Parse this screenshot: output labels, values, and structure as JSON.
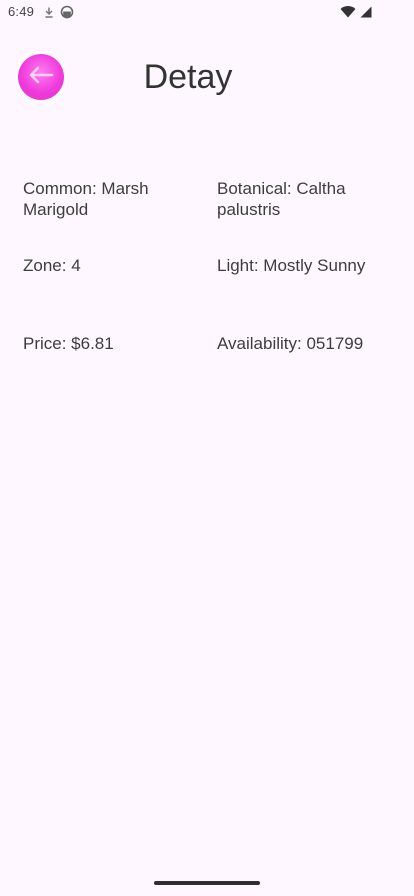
{
  "status_bar": {
    "time": "6:49"
  },
  "header": {
    "title": "Detay"
  },
  "details": {
    "common": "Common: Marsh Marigold",
    "botanical": "Botanical: Caltha palustris",
    "zone": "Zone: 4",
    "light": "Light: Mostly Sunny",
    "price": "Price: $6.81",
    "availability": "Availability: 051799"
  },
  "colors": {
    "background": "#FEF7FF",
    "accent": "#F03BDC"
  },
  "icons": {
    "back": "arrow-left-icon"
  }
}
